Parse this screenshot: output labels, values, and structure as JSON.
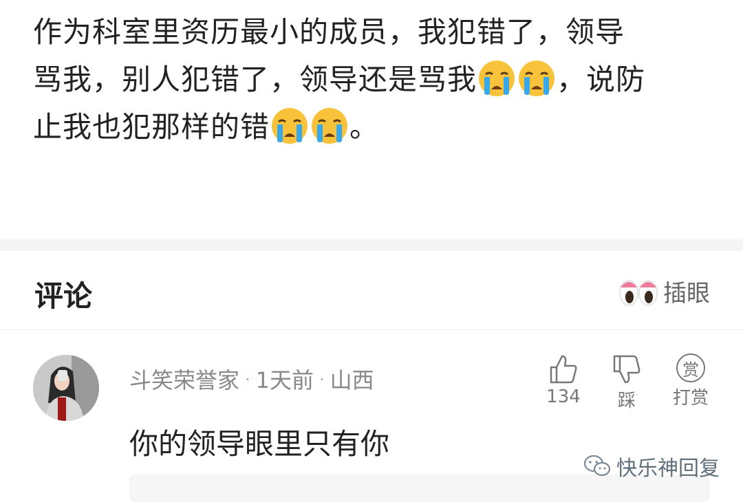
{
  "post": {
    "lines": [
      {
        "text": "作为科室里资历最小的成员，我犯错了，领导"
      },
      {
        "text": "骂我，别人犯错了，领导还是骂我",
        "after": "，说防"
      },
      {
        "text": "止我也犯那样的错",
        "after": "。"
      }
    ],
    "emoji_name": "crying-face-icon"
  },
  "comments_header": {
    "title": "评论",
    "peek_label": "插眼",
    "peek_icon": "eyes-icon"
  },
  "comment": {
    "username": "斗笑荣誉家",
    "time": "1天前",
    "location": "山西",
    "text": "你的领导眼里只有你",
    "like_count": "134",
    "dislike_label": "踩",
    "tip_icon_text": "赏",
    "tip_label": "打赏"
  },
  "watermark": {
    "text": "快乐神回复",
    "icon": "wechat-icon"
  },
  "colors": {
    "separator": "#f4f4f4",
    "meta_text": "#888888",
    "emoji_yellow": "#f8c33a",
    "tear_blue": "#38a8e8"
  }
}
